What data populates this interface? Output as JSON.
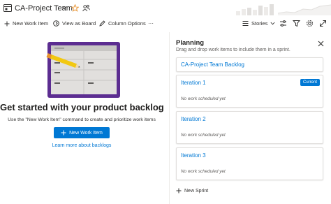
{
  "header": {
    "team_name": "CA-Project Team",
    "icons": [
      "team-icon",
      "chevron-down-icon",
      "star-icon",
      "team-members-icon",
      "velocity-chart-icon"
    ]
  },
  "toolbar": {
    "new_work_item": "New Work Item",
    "view_as_board": "View as Board",
    "column_options": "Column Options",
    "more": "···",
    "level_selector": "Stories",
    "right_icons": [
      "settings-sliders-icon",
      "filter-icon",
      "gear-icon",
      "expand-icon"
    ]
  },
  "empty_state": {
    "title": "Get started with your product backlog",
    "subtitle": "Use the \"New Work Item\" command to create and prioritize work items",
    "button_label": "New Work Item",
    "link": "Learn more about backlogs"
  },
  "planning": {
    "title": "Planning",
    "subtitle": "Drag and drop work items to include them in a sprint.",
    "backlog_label": "CA-Project Team Backlog",
    "iterations": [
      {
        "name": "Iteration 1",
        "badge": "Current",
        "note": "No work scheduled yet"
      },
      {
        "name": "Iteration 2",
        "badge": "",
        "note": "No work scheduled yet"
      },
      {
        "name": "Iteration 3",
        "badge": "",
        "note": "No work scheduled yet"
      }
    ],
    "new_sprint": "New Sprint"
  },
  "colors": {
    "accent": "#0078d4",
    "star": "#e8912d",
    "illustration_frame": "#5c2d91",
    "pencil": "#f2c811"
  }
}
